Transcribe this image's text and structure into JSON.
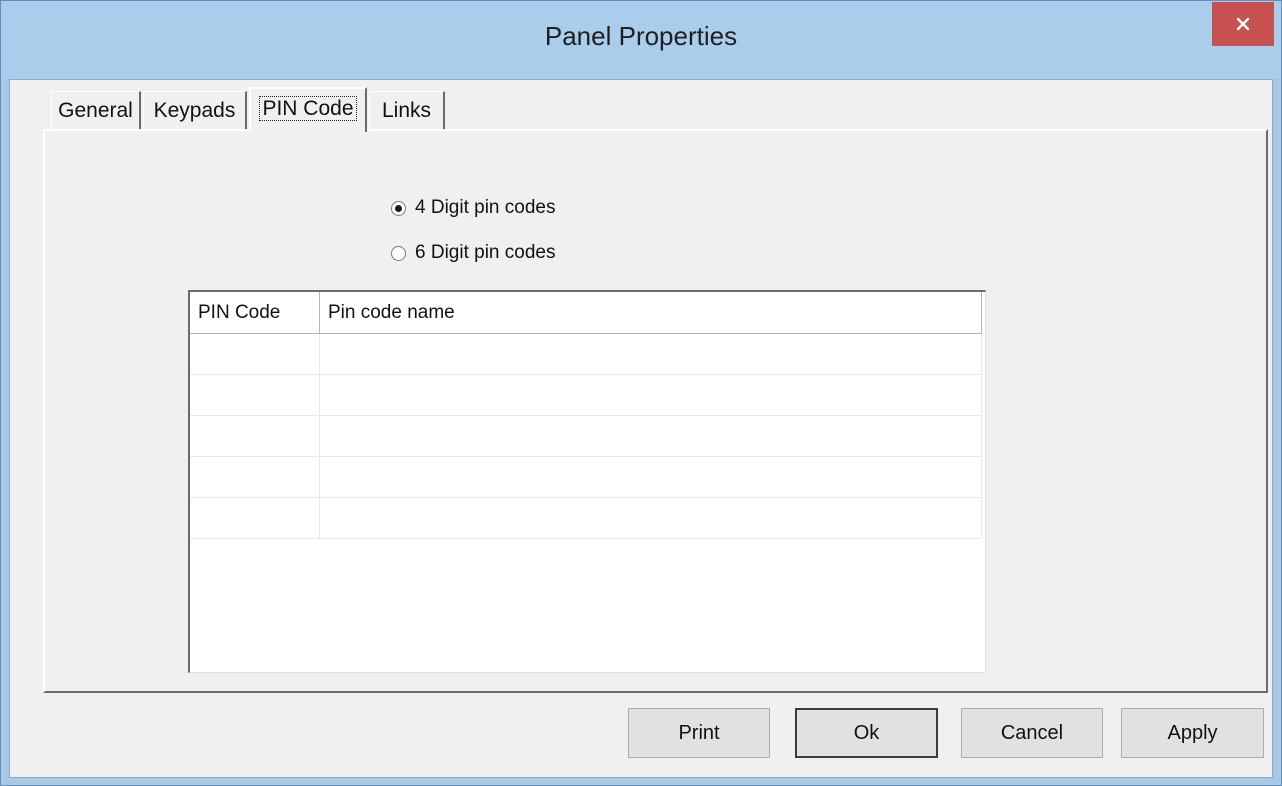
{
  "window": {
    "title": "Panel Properties"
  },
  "tabs": [
    {
      "label": "General",
      "active": false
    },
    {
      "label": "Keypads",
      "active": false
    },
    {
      "label": "PIN Code",
      "active": true
    },
    {
      "label": "Links",
      "active": false
    }
  ],
  "pin_options": {
    "four_digit_label": "4 Digit pin codes",
    "six_digit_label": "6 Digit pin codes",
    "selected": "4 Digit pin codes"
  },
  "pin_list": {
    "columns": [
      "PIN Code",
      "Pin code name"
    ],
    "rows": [
      [
        "",
        ""
      ],
      [
        "",
        ""
      ],
      [
        "",
        ""
      ],
      [
        "",
        ""
      ],
      [
        "",
        ""
      ]
    ]
  },
  "buttons": {
    "print": "Print",
    "ok": "Ok",
    "cancel": "Cancel",
    "apply": "Apply"
  },
  "colors": {
    "titlebar": "#aacdeb",
    "close_button": "#c75050",
    "dialog_face": "#f0f0f0"
  }
}
